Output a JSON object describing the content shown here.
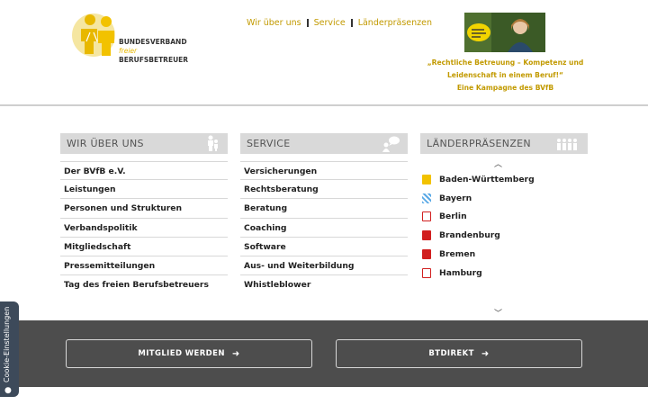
{
  "logo": {
    "line1": "BUNDESVERBAND",
    "line2": "freier",
    "line3": "BERUFSBETREUER"
  },
  "topnav": [
    {
      "label": "Wir über uns"
    },
    {
      "label": "Service"
    },
    {
      "label": "Länderpräsenzen"
    }
  ],
  "campaign": {
    "line1": "„Rechtliche Betreuung – Kompetenz und",
    "line2": "Leidenschaft in einem Beruf!“",
    "line3": "Eine Kampagne des BVfB"
  },
  "columns": {
    "about": {
      "title": "WIR ÜBER UNS",
      "items": [
        "Der BVfB e.V.",
        "Leistungen",
        "Personen und Strukturen",
        "Verbandspolitik",
        "Mitgliedschaft",
        "Pressemitteilungen",
        "Tag des freien Berufsbetreuers"
      ]
    },
    "service": {
      "title": "SERVICE",
      "items": [
        "Versicherungen",
        "Rechtsberatung",
        "Beratung",
        "Coaching",
        "Software",
        "Aus- und Weiterbildung",
        "Whistleblower"
      ]
    },
    "laender": {
      "title": "LÄNDERPRÄSENZEN",
      "items": [
        {
          "name": "Baden-Württemberg",
          "color": "#f2c200"
        },
        {
          "name": "Bayern",
          "color": "#5aa9e6"
        },
        {
          "name": "Berlin",
          "color": "#d11f1f"
        },
        {
          "name": "Brandenburg",
          "color": "#d11f1f"
        },
        {
          "name": "Bremen",
          "color": "#d11f1f"
        },
        {
          "name": "Hamburg",
          "color": "#d11f1f"
        }
      ]
    }
  },
  "cta": {
    "member": "MITGLIED WERDEN",
    "btdirekt": "BTDIREKT"
  },
  "cookie": {
    "label": "Cookie-Einstellungen"
  },
  "colors": {
    "accent": "#c29a00",
    "band": "#4d4d4d",
    "head": "#d9d9d9"
  }
}
